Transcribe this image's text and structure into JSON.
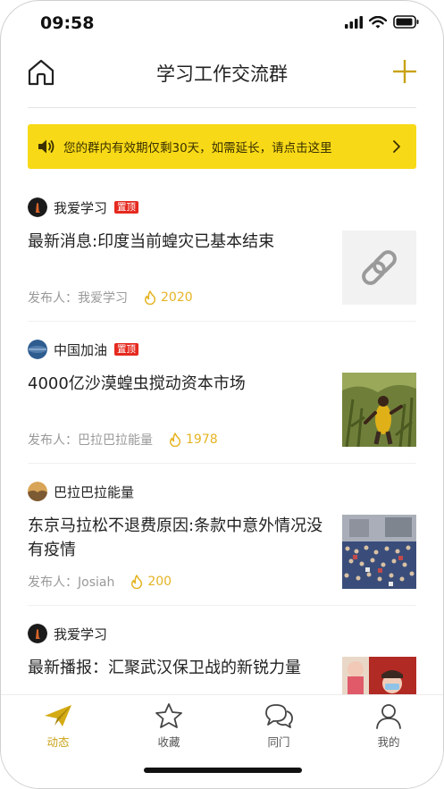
{
  "status_bar": {
    "time": "09:58"
  },
  "header": {
    "title": "学习工作交流群"
  },
  "banner": {
    "text": "您的群内有效期仅剩30天，如需延长，请点击这里"
  },
  "feed": [
    {
      "group": "我爱学习",
      "pinned": true,
      "pin_label": "置顶",
      "title": "最新消息:印度当前蝗灾已基本结束",
      "publisher": "发布人：我爱学习",
      "count": "2020",
      "thumb": "link-icon"
    },
    {
      "group": "中国加油",
      "pinned": true,
      "pin_label": "置顶",
      "title": "4000亿沙漠蝗虫搅动资本市场",
      "publisher": "发布人：巴拉巴拉能量",
      "count": "1978",
      "thumb": "photo-field"
    },
    {
      "group": "巴拉巴拉能量",
      "pinned": false,
      "title": "东京马拉松不退费原因:条款中意外情况没有疫情",
      "publisher": "发布人：Josiah",
      "count": "200",
      "thumb": "photo-crowd"
    },
    {
      "group": "我爱学习",
      "pinned": false,
      "title": "最新播报：汇聚武汉保卫战的新锐力量",
      "publisher": "",
      "count": "",
      "thumb": "photo-people"
    }
  ],
  "tabbar": {
    "tabs": [
      {
        "label": "动态",
        "icon": "paper-plane-icon",
        "active": true
      },
      {
        "label": "收藏",
        "icon": "star-icon",
        "active": false
      },
      {
        "label": "同门",
        "icon": "chat-bubbles-icon",
        "active": false
      },
      {
        "label": "我的",
        "icon": "person-icon",
        "active": false
      }
    ]
  },
  "colors": {
    "accent": "#c9a215",
    "banner_bg": "#f7d917",
    "pin_red": "#e5291f",
    "count_color": "#e5b423"
  }
}
